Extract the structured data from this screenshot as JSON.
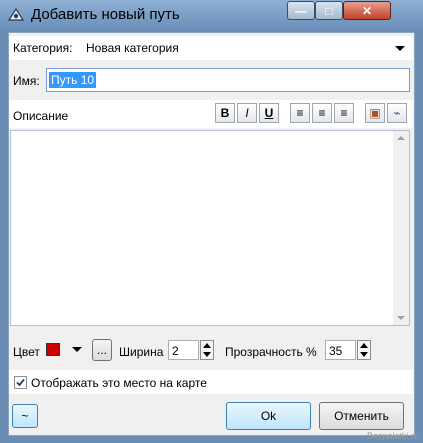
{
  "window": {
    "title": "Добавить новый путь",
    "buttons": {
      "minimize": "—",
      "maximize": "□",
      "close": "✕"
    }
  },
  "category": {
    "label": "Категория:",
    "value": "Новая категория"
  },
  "name": {
    "label": "Имя:",
    "value": "Путь 10"
  },
  "description": {
    "label": "Описание",
    "toolbar": {
      "bold": "B",
      "italic": "I",
      "underline": "U",
      "align_left": "≡",
      "align_center": "≡",
      "align_right": "≡",
      "image": "▣",
      "link": "⌁"
    }
  },
  "style": {
    "color_label": "Цвет",
    "color_value": "#cc0000",
    "more_button": "...",
    "width_label": "Ширина",
    "width_value": "2",
    "opacity_label": "Прозрачность %",
    "opacity_value": "35"
  },
  "show_on_map": {
    "label": "Отображать это место на карте",
    "checked": true
  },
  "buttons": {
    "tilde": "~",
    "ok": "Ok",
    "cancel": "Отменить"
  },
  "watermark": "Bezpalatki.ru"
}
